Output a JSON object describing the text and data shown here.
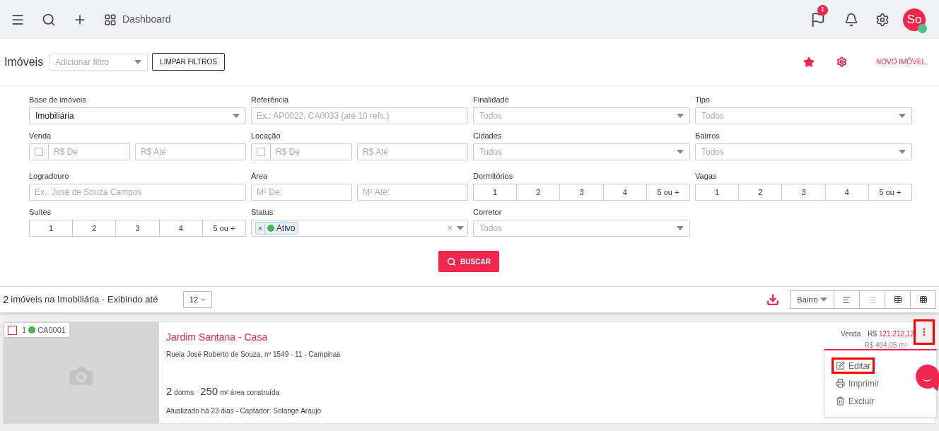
{
  "topbar": {
    "dashboard_label": "Dashboard",
    "flag_badge": "1",
    "avatar_initials": "So",
    "avatar_online": true
  },
  "header": {
    "title": "Imóveis",
    "filter_placeholder": "Adicionar filtro",
    "clear_button": "LIMPAR FILTROS",
    "new_button": "NOVO IMÓVEL"
  },
  "filters": [
    {
      "label": "Base de imóveis",
      "kind": "select",
      "value": "Imobiliária"
    },
    {
      "label": "Referência",
      "kind": "text",
      "placeholder": "Ex.: AP0022, CA0033 (até 10 refs.)"
    },
    {
      "label": "Finalidade",
      "kind": "select",
      "placeholder": "Todos"
    },
    {
      "label": "Tipo",
      "kind": "select",
      "placeholder": "Todos"
    },
    {
      "label": "Venda",
      "kind": "range_check",
      "checked": false,
      "from": "R$ De",
      "to": "R$ Até"
    },
    {
      "label": "Locação",
      "kind": "range_check",
      "checked": false,
      "from": "R$ De",
      "to": "R$ Até"
    },
    {
      "label": "Cidades",
      "kind": "select",
      "placeholder": "Todos"
    },
    {
      "label": "Bairros",
      "kind": "select",
      "placeholder": "Todos"
    },
    {
      "label": "Logradouro",
      "kind": "text",
      "placeholder": "Ex.: José de Souza Campos"
    },
    {
      "label": "Área",
      "kind": "range",
      "from": "M² De:",
      "to": "M² Até:"
    },
    {
      "label": "Dormitórios",
      "kind": "buttons",
      "options": [
        {
          "label": "1",
          "selected": false
        },
        {
          "label": "2",
          "selected": false
        },
        {
          "label": "3",
          "selected": false
        },
        {
          "label": "4",
          "selected": false
        },
        {
          "label": "5 ou +",
          "selected": false
        }
      ]
    },
    {
      "label": "Vagas",
      "kind": "buttons",
      "options": [
        {
          "label": "1",
          "selected": false
        },
        {
          "label": "2",
          "selected": false
        },
        {
          "label": "3",
          "selected": false
        },
        {
          "label": "4",
          "selected": false
        },
        {
          "label": "5 ou +",
          "selected": false
        }
      ]
    },
    {
      "label": "Suítes",
      "kind": "buttons",
      "options": [
        {
          "label": "1",
          "selected": false
        },
        {
          "label": "2",
          "selected": false
        },
        {
          "label": "3",
          "selected": false
        },
        {
          "label": "4",
          "selected": false
        },
        {
          "label": "5 ou +",
          "selected": false
        }
      ]
    },
    {
      "label": "Status",
      "kind": "tags",
      "tags": [
        {
          "label": "Ativo",
          "remove": "×",
          "color": "#4caf50"
        }
      ],
      "clear": "×"
    },
    {
      "label": "Corretor",
      "kind": "select",
      "placeholder": "Todos"
    }
  ],
  "search_button": "BUSCAR",
  "results": {
    "count": "2",
    "text": "imóveis na Imobiliária - Exibindo até",
    "per_page": "12",
    "sort": "Bairro"
  },
  "listing": {
    "checked": false,
    "number": "1",
    "color": "#4caf50",
    "code": "CA0001",
    "title": "Jardim Santana - Casa",
    "address": "Ruela José Roberto de Souza, nº 1549 - 11 - Campinas",
    "dorms": "2",
    "dorms_unit": "dorms",
    "area": "250",
    "area_unit": "m² área construída",
    "updated": "Atualizado há 23 dias - Captador: Solange Araujo",
    "price_label": "Venda",
    "currency": "R$",
    "price": "121.212,12",
    "price_m2": "R$ 404,05 m²",
    "menu_highlighted": true
  },
  "menu": [
    {
      "label": "Editar",
      "kind": "edit",
      "highlighted": true
    },
    {
      "label": "Imprimir",
      "kind": "print",
      "highlighted": false
    },
    {
      "label": "Excluir",
      "kind": "delete",
      "highlighted": false
    }
  ]
}
